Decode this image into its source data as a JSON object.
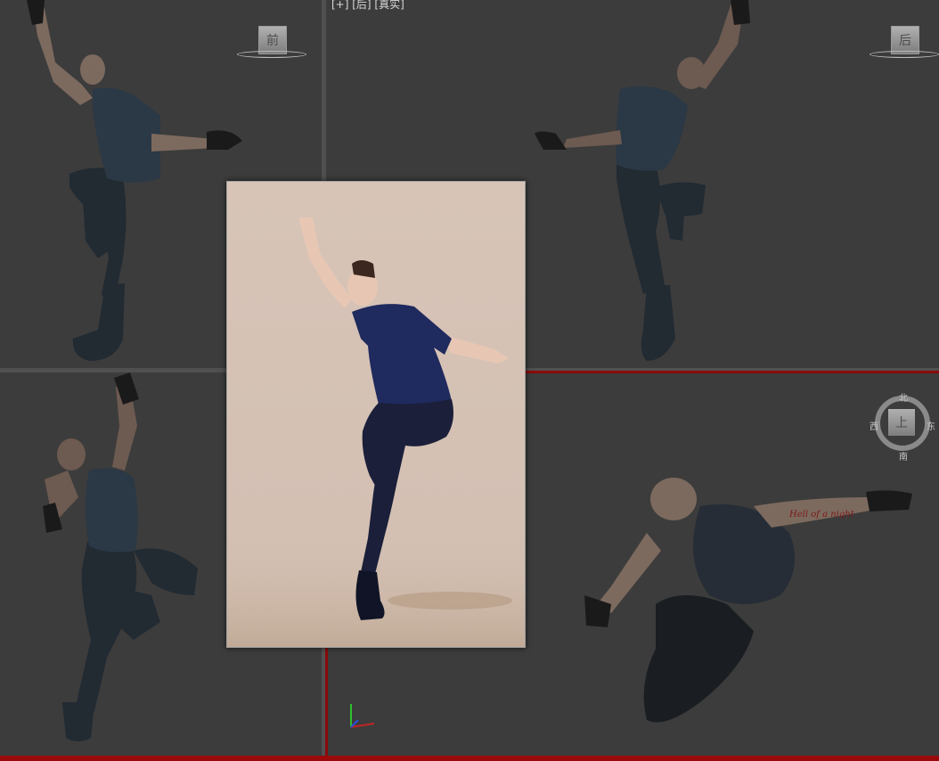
{
  "viewports": {
    "front": {
      "label": "",
      "cube_face": "前"
    },
    "back": {
      "label": "[+] [后] [真实]",
      "cube_face": "后"
    },
    "left": {
      "label": ""
    },
    "top": {
      "label": "",
      "cube_face": "上",
      "compass": {
        "north": "北",
        "south": "南",
        "east": "东",
        "west": "西"
      }
    }
  },
  "tattoo_text": "Hell of a night",
  "colors": {
    "viewport_bg": "#3c3c3c",
    "active_border": "#8a0a0a",
    "photo_bg": "#d5c2b5",
    "shirt_navy": "#1f2a5e",
    "figure_skin": "#7d6a5e",
    "figure_cloth": "#222a32"
  },
  "icons": [
    "viewcube-front-icon",
    "viewcube-back-icon",
    "viewcube-top-icon",
    "compass-ring-icon",
    "axis-gizmo-icon"
  ]
}
